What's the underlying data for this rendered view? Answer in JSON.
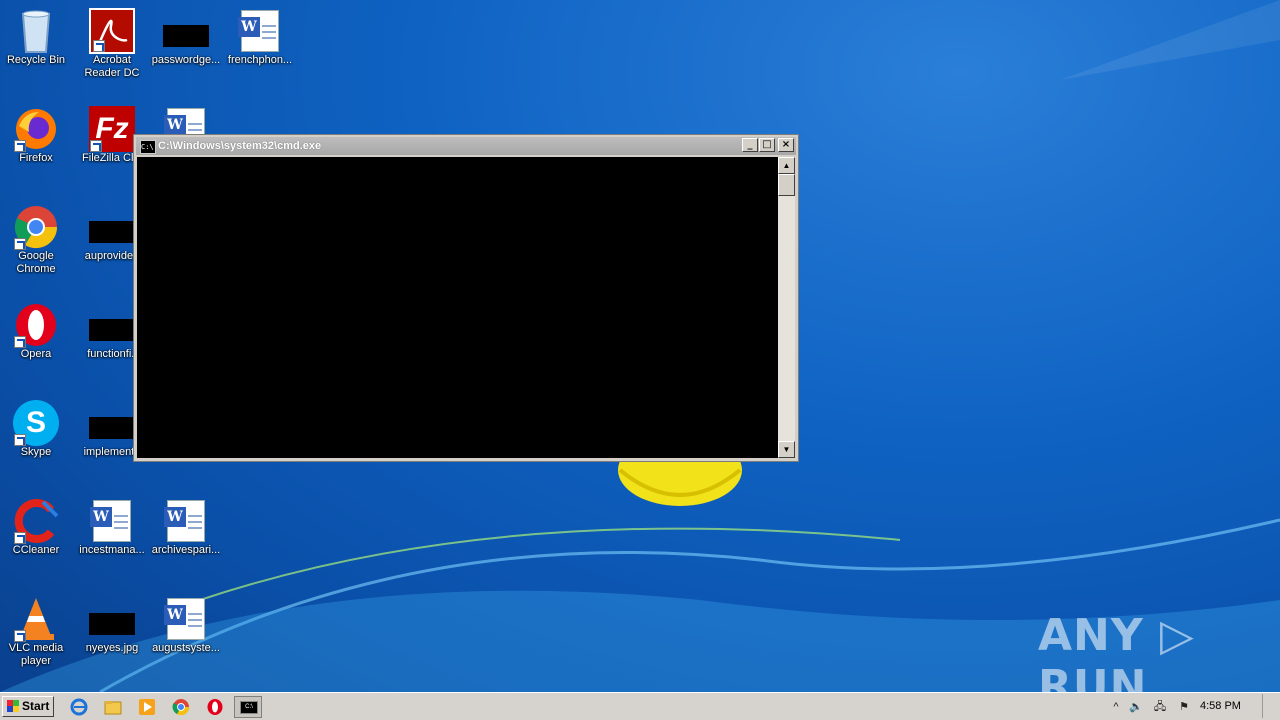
{
  "desktop": {
    "icons": [
      {
        "label": "Recycle Bin"
      },
      {
        "label": "Acrobat Reader DC"
      },
      {
        "label": "passwordge..."
      },
      {
        "label": "frenchphon..."
      },
      {
        "label": "Firefox"
      },
      {
        "label": "FileZilla Clie"
      },
      {
        "label": "Google Chrome"
      },
      {
        "label": "auprovider."
      },
      {
        "label": "Opera"
      },
      {
        "label": "functionfi.j"
      },
      {
        "label": "Skype"
      },
      {
        "label": "implementa"
      },
      {
        "label": "CCleaner"
      },
      {
        "label": "incestmana..."
      },
      {
        "label": "archivespari..."
      },
      {
        "label": "VLC media player"
      },
      {
        "label": "nyeyes.jpg"
      },
      {
        "label": "augustsyste..."
      }
    ]
  },
  "cmd_window": {
    "title": "C:\\Windows\\system32\\cmd.exe",
    "icon_text": "C:\\",
    "minimize": "_",
    "maximize": "□",
    "close": "×",
    "scroll_up": "▲",
    "scroll_down": "▼"
  },
  "taskbar": {
    "start_label": "Start",
    "clock": "4:58 PM",
    "tray_expand": "^"
  },
  "watermark": "ANY ▷ RUN",
  "colors": {
    "desktop_blue": "#0f62c2",
    "console_bg": "#000000",
    "taskbar_bg": "#d6d3ce"
  }
}
